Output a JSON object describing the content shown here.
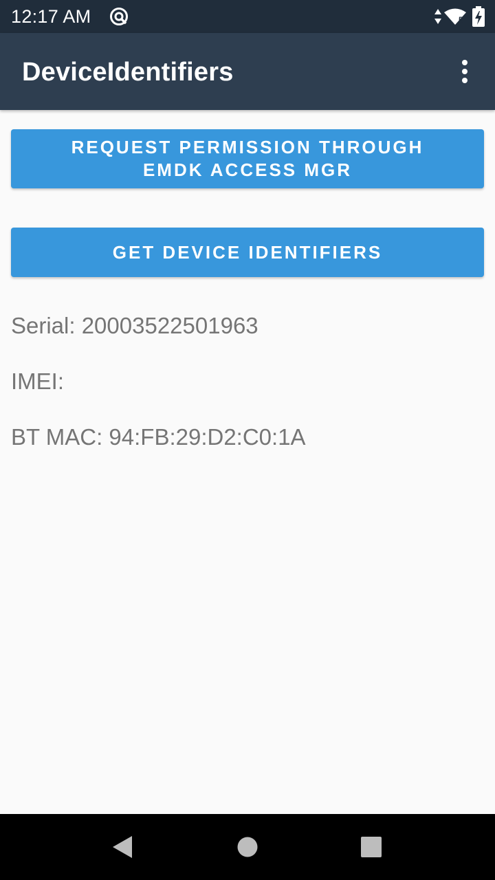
{
  "status_bar": {
    "time": "12:17 AM",
    "icons": [
      "sync-icon",
      "data-arrows-icon",
      "wifi-icon",
      "battery-charging-icon"
    ]
  },
  "app_bar": {
    "title": "DeviceIdentifiers",
    "overflow_icon": "more-vert-icon",
    "color": "#2e3e50"
  },
  "buttons": {
    "request_permission": "REQUEST PERMISSION THROUGH EMDK ACCESS MGR",
    "get_identifiers": "GET DEVICE IDENTIFIERS",
    "color": "#3897dc"
  },
  "identifiers": {
    "serial": "Serial: 20003522501963",
    "imei": "IMEI:",
    "bt_mac": "BT MAC: 94:FB:29:D2:C0:1A"
  },
  "nav_bar": {
    "icons": [
      "back-icon",
      "home-icon",
      "recents-icon"
    ]
  }
}
